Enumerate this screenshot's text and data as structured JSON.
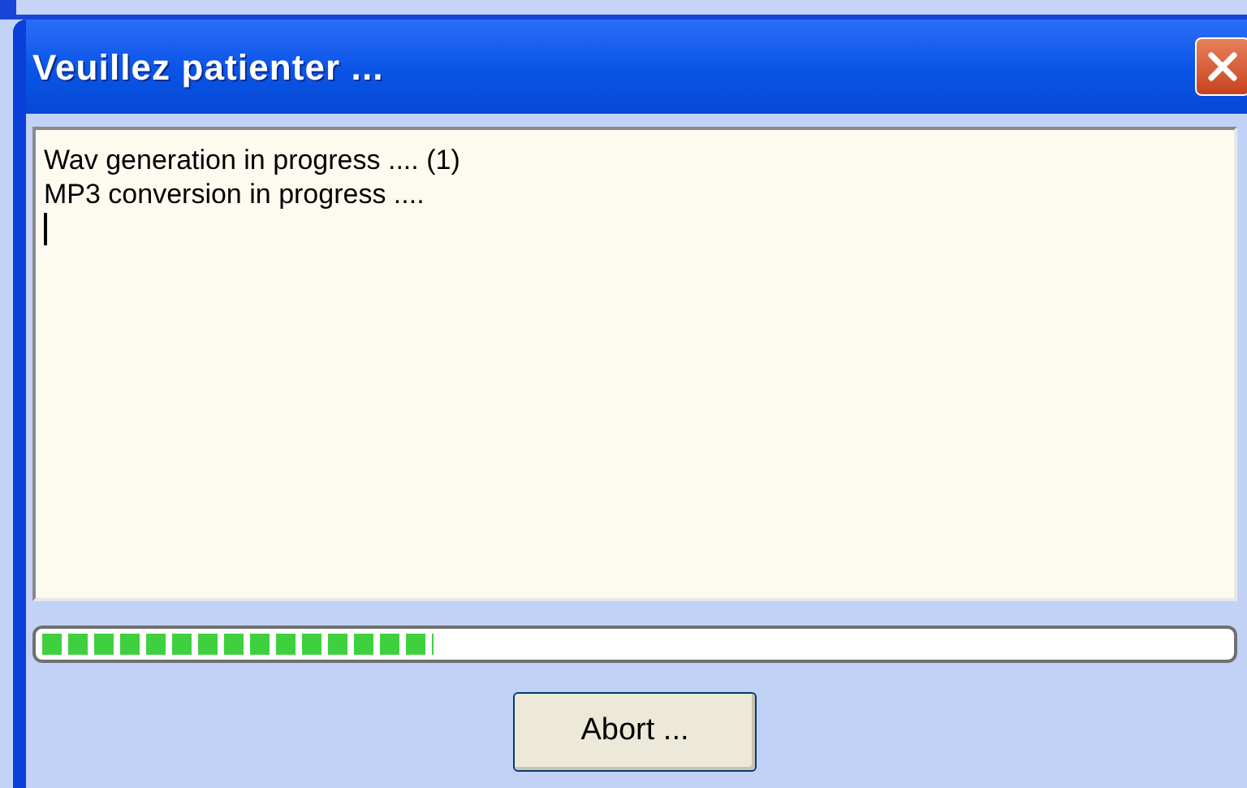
{
  "window": {
    "title": "Veuillez patienter ..."
  },
  "log": {
    "lines": [
      "Wav generation in progress .... (1)",
      "MP3 conversion in progress ...."
    ]
  },
  "progress": {
    "level": 0.33
  },
  "buttons": [
    "Abort ..."
  ]
}
